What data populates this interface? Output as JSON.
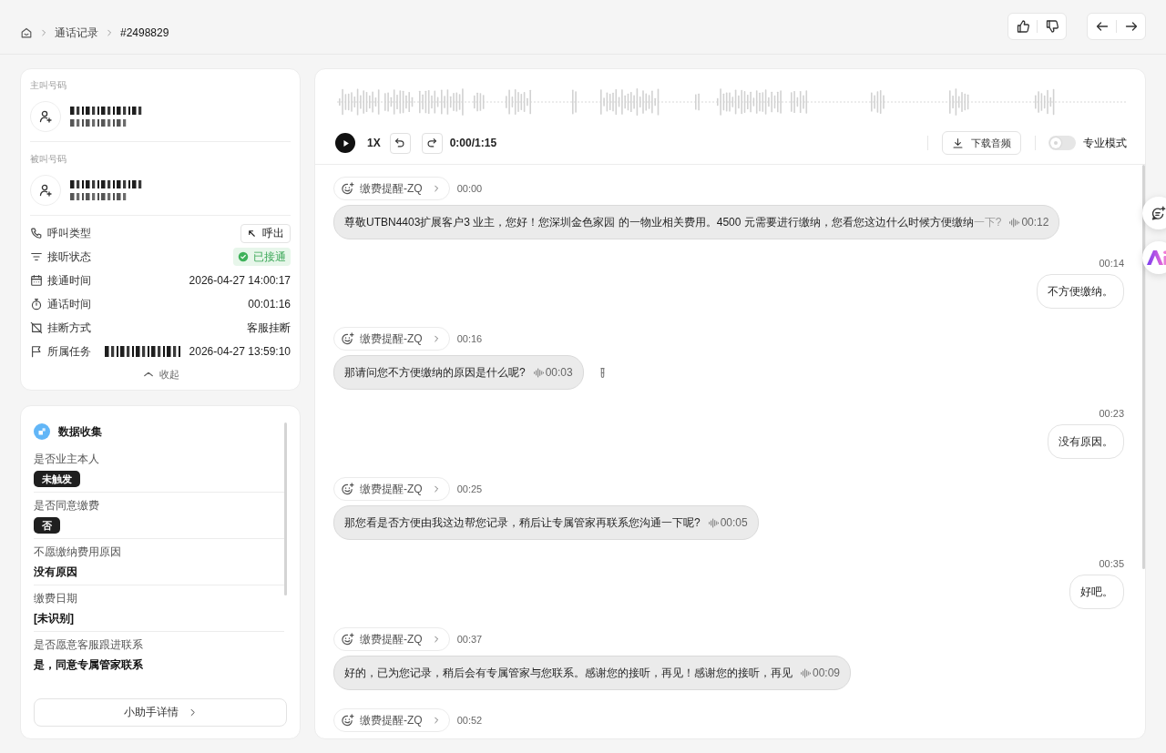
{
  "breadcrumb": [
    {
      "label": "通话记录",
      "current": false
    },
    {
      "label": "#2498829",
      "current": true
    }
  ],
  "parties": [
    {
      "label": "主叫号码"
    },
    {
      "label": "被叫号码"
    }
  ],
  "details": [
    {
      "label": "呼叫类型",
      "kind": "button",
      "value": "呼出",
      "redacted": false
    },
    {
      "label": "接听状态",
      "kind": "status",
      "value": "已接通",
      "redacted": false
    },
    {
      "label": "接通时间",
      "kind": "text",
      "value": "2026-04-27 14:00:17",
      "redacted": false
    },
    {
      "label": "通话时间",
      "kind": "text",
      "value": "00:01:16",
      "redacted": false
    },
    {
      "label": "挂断方式",
      "kind": "text",
      "value": "客服挂断",
      "redacted": false
    },
    {
      "label": "所属任务",
      "kind": "text",
      "value": "2026-04-27 13:59:10",
      "redacted": true
    }
  ],
  "collapse": "收起",
  "data_collection": {
    "title": "数据收集",
    "fields": [
      {
        "label": "是否业主本人",
        "kind": "tag",
        "value": "未触发"
      },
      {
        "label": "是否同意缴费",
        "kind": "tag",
        "value": "否"
      },
      {
        "label": "不愿缴纳费用原因",
        "kind": "text",
        "value": "没有原因"
      },
      {
        "label": "缴费日期",
        "kind": "text",
        "value": "[未识别]"
      },
      {
        "label": "是否愿意客服跟进联系",
        "kind": "text",
        "value": "是，同意专属管家联系"
      }
    ],
    "button": "小助手详情"
  },
  "player": {
    "speed": "1X",
    "time": "0:00/1:15",
    "download": "下载音频",
    "pro_mode": {
      "label": "专业模式",
      "on": false
    }
  },
  "messages": [
    {
      "kind": "agent",
      "bot": "缴费提醒-ZQ",
      "time": "00:00",
      "text": "尊敬UTBN4403扩展客户3 业主，您好！您深圳金色家园 的一物业相关费用。4500 元需要进行缴纳，您看您这边什么时候方便缴纳",
      "tail": "一下?",
      "duration": "00:12",
      "marked": false
    },
    {
      "kind": "user",
      "time": "00:14",
      "text": "不方便缴纳。"
    },
    {
      "kind": "agent",
      "bot": "缴费提醒-ZQ",
      "time": "00:16",
      "text": "那请问您不方便缴纳的原因是什么呢?",
      "duration": "00:03",
      "marked": true
    },
    {
      "kind": "user",
      "time": "00:23",
      "text": "没有原因。"
    },
    {
      "kind": "agent",
      "bot": "缴费提醒-ZQ",
      "time": "00:25",
      "text": "那您看是否方便由我这边帮您记录，稍后让专属管家再联系您沟通一下呢?",
      "duration": "00:05",
      "marked": false
    },
    {
      "kind": "user",
      "time": "00:35",
      "text": "好吧。"
    },
    {
      "kind": "agent",
      "bot": "缴费提醒-ZQ",
      "time": "00:37",
      "text": "好的，已为您记录，稍后会有专属管家与您联系。感谢您的接听，再见！感谢您的接听，再见",
      "duration": "00:09",
      "marked": false
    },
    {
      "kind": "agent",
      "bot": "缴费提醒-ZQ",
      "time": "00:52",
      "marked": false
    }
  ]
}
